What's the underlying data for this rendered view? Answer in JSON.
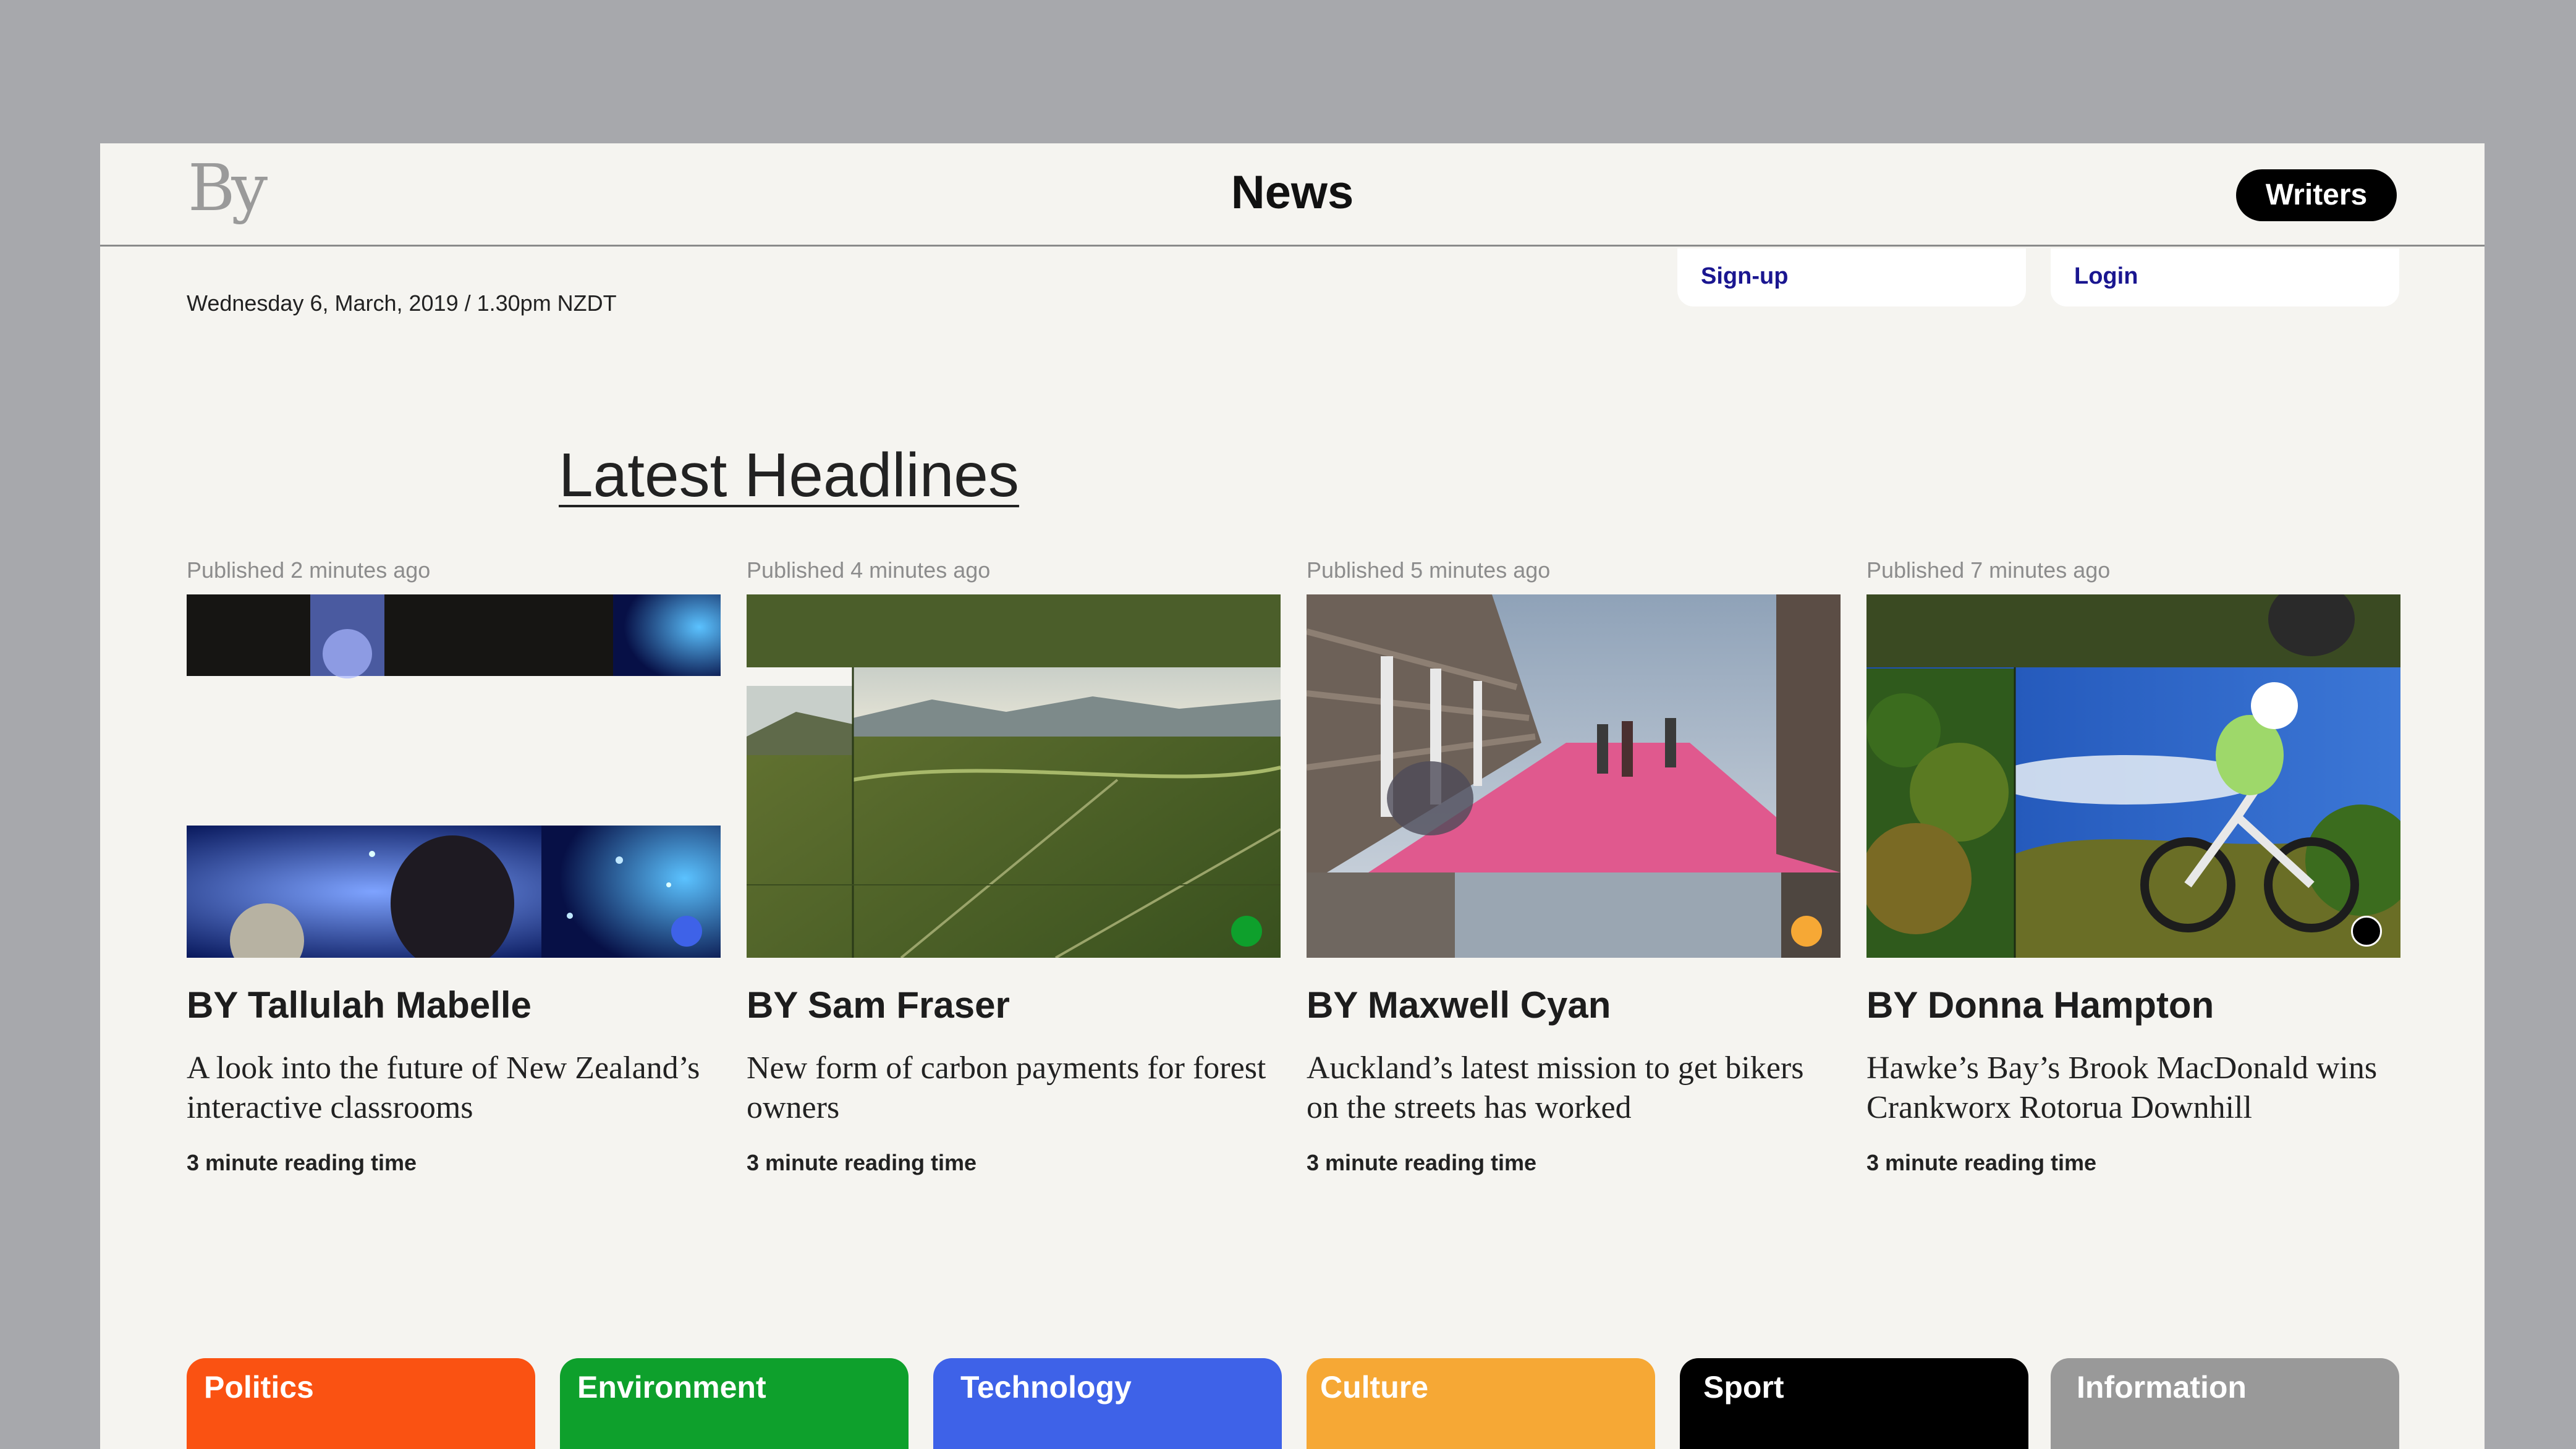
{
  "header": {
    "logo": "By",
    "title": "News",
    "writers_label": "Writers"
  },
  "auth": {
    "signup_label": "Sign-up",
    "login_label": "Login"
  },
  "date_line": "Wednesday 6, March, 2019 / 1.30pm NZDT",
  "section_title": "Latest Headlines",
  "articles": [
    {
      "published": "Published 2 minutes ago",
      "author": "BY Tallulah Mabelle",
      "headline": "A look into the future of New Zealand’s interactive classrooms",
      "reading_time": "3 minute reading time",
      "category_color": "#3e62e8"
    },
    {
      "published": "Published 4 minutes ago",
      "author": "BY Sam Fraser",
      "headline": "New form of carbon payments for forest owners",
      "reading_time": "3 minute reading time",
      "category_color": "#0ea02c"
    },
    {
      "published": "Published 5 minutes ago",
      "author": "BY Maxwell Cyan",
      "headline": "Auckland’s latest mission to get bikers on the streets has worked",
      "reading_time": "3 minute reading time",
      "category_color": "#f6a835"
    },
    {
      "published": "Published 7 minutes ago",
      "author": "BY Donna Hampton",
      "headline": "Hawke’s Bay’s Brook MacDonald wins Crankworx Rotorua Downhill",
      "reading_time": "3 minute reading time",
      "category_color": "#000000"
    }
  ],
  "categories": [
    {
      "label": "Politics",
      "color": "#fa5212"
    },
    {
      "label": "Environment",
      "color": "#0ea02c"
    },
    {
      "label": "Technology",
      "color": "#3e62e8"
    },
    {
      "label": "Culture",
      "color": "#f6a835"
    },
    {
      "label": "Sport",
      "color": "#000000"
    },
    {
      "label": "Information",
      "color": "#999999"
    }
  ]
}
